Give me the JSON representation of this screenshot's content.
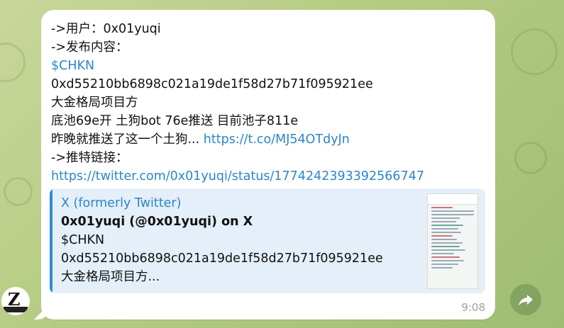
{
  "message": {
    "lines": [
      "->用户：0x01yuqi",
      "->发布内容：",
      "$CHKN",
      "0xd55210bb6898c021a19de1f58d27b71f095921ee",
      "大金格局项目方",
      "底池69e开  土狗bot 76e推送  目前池子811e",
      "昨晚就推送了这一个土狗...",
      "->推特链接：",
      "https://twitter.com/0x01yuqi/status/1774242393392566747"
    ],
    "inline_link": "https://t.co/MJ54OTdyJn",
    "time": "9:08"
  },
  "preview": {
    "site": "X (formerly Twitter)",
    "title": "0x01yuqi (@0x01yuqi) on X",
    "line1": "$CHKN",
    "line2": "0xd55210bb6898c021a19de1f58d27b71f095921ee",
    "line3": "大金格局项目方..."
  },
  "icons": {
    "avatar": "z-logo-avatar",
    "forward": "share-arrow-icon"
  },
  "colors": {
    "link": "#2c86c9",
    "preview_bar": "#2e8bd3",
    "preview_bg": "#e4eff9"
  }
}
